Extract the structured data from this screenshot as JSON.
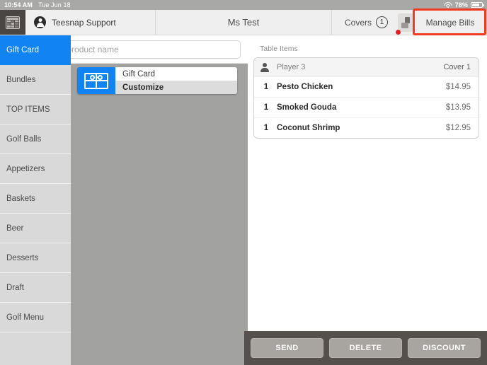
{
  "statusbar": {
    "time": "10:54 AM",
    "date": "Tue Jun 18",
    "battery_percent": "78%",
    "wifi_icon": "wifi-icon",
    "battery_icon": "battery-icon"
  },
  "navbar": {
    "grid_icon": "grid-menu-icon",
    "user_icon": "person-icon",
    "user_label": "Teesnap Support",
    "title": "Ms Test",
    "covers_label": "Covers",
    "covers_count": "1",
    "device_icon": "printer-device-icon",
    "manage_bills_label": "Manage Bills",
    "highlight_color": "#f03a21"
  },
  "search": {
    "placeholder": "Search by product name",
    "value": "",
    "icon": "search-icon"
  },
  "sidebar": {
    "active_index": 0,
    "items": [
      {
        "label": "Gift Card"
      },
      {
        "label": "Bundles"
      },
      {
        "label": "TOP ITEMS"
      },
      {
        "label": "Golf Balls"
      },
      {
        "label": "Appetizers"
      },
      {
        "label": "Baskets"
      },
      {
        "label": "Beer"
      },
      {
        "label": "Desserts"
      },
      {
        "label": "Draft"
      },
      {
        "label": "Golf Menu"
      }
    ],
    "active_color": "#1283f2"
  },
  "products": [
    {
      "name": "Gift Card",
      "action_label": "Customize",
      "icon": "gift-card-icon",
      "icon_bg": "#1283f2"
    }
  ],
  "order": {
    "section_label": "Table Items",
    "player_icon": "person-avatar-icon",
    "player_name": "Player 3",
    "cover_label": "Cover 1",
    "items": [
      {
        "qty": "1",
        "name": "Pesto Chicken",
        "price": "$14.95"
      },
      {
        "qty": "1",
        "name": "Smoked Gouda",
        "price": "$13.95"
      },
      {
        "qty": "1",
        "name": "Coconut Shrimp",
        "price": "$12.95"
      }
    ]
  },
  "footer": {
    "buttons": [
      {
        "label": "SEND"
      },
      {
        "label": "DELETE"
      },
      {
        "label": "DISCOUNT"
      }
    ],
    "background": "#56504c"
  }
}
